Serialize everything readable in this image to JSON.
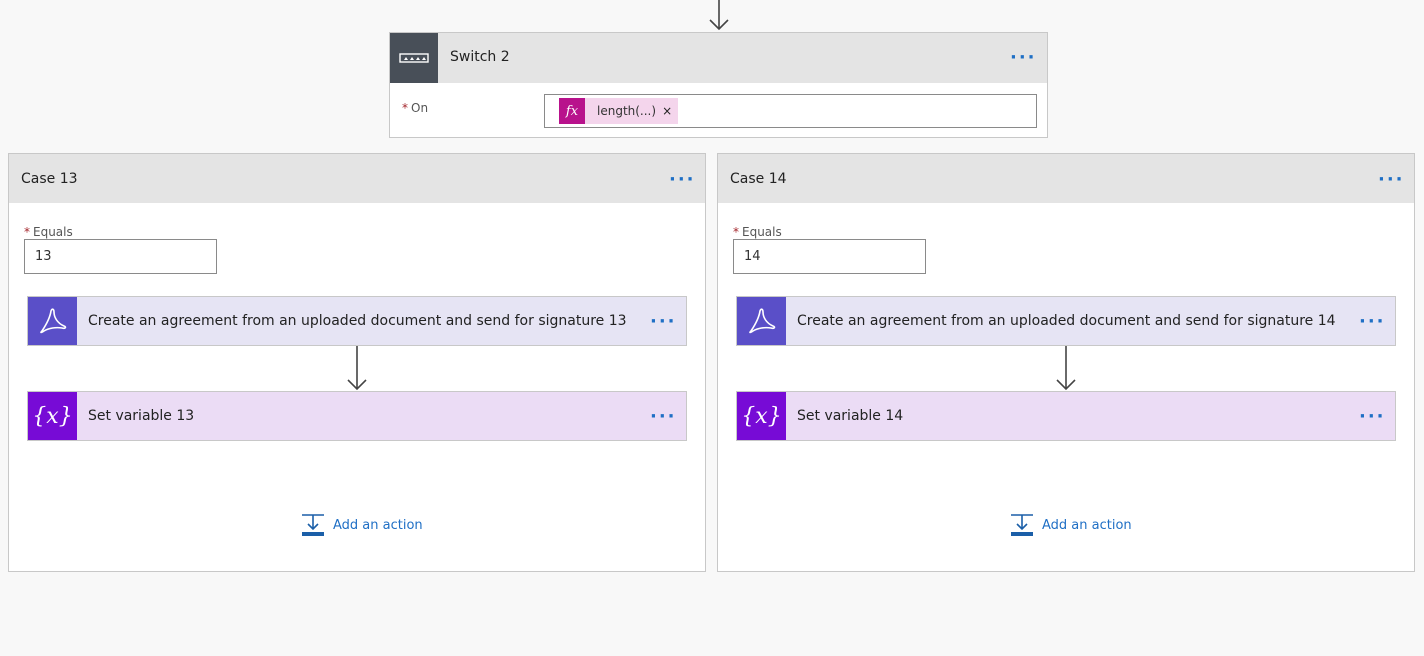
{
  "switch": {
    "title": "Switch 2",
    "on_required": "*",
    "on_label": "On",
    "token_icon": "fx",
    "token_text": "length(...)",
    "token_close": "×",
    "more": "···"
  },
  "cases": [
    {
      "title": "Case 13",
      "more": "···",
      "equals_required": "*",
      "equals_label": "Equals",
      "equals_value": "13",
      "actions": [
        {
          "label": "Create an agreement from an uploaded document and send for signature 13",
          "more": "···"
        },
        {
          "label": "Set variable 13",
          "icon": "{x}",
          "more": "···"
        }
      ],
      "add_action": "Add an action"
    },
    {
      "title": "Case 14",
      "more": "···",
      "equals_required": "*",
      "equals_label": "Equals",
      "equals_value": "14",
      "actions": [
        {
          "label": "Create an agreement from an uploaded document and send for signature 14",
          "more": "···"
        },
        {
          "label": "Set variable 14",
          "icon": "{x}",
          "more": "···"
        }
      ],
      "add_action": "Add an action"
    }
  ],
  "colors": {
    "switch_icon_bg": "#484f58",
    "adobe_icon_bg": "#5a4fc8",
    "variable_icon_bg": "#770bd6",
    "expression_token_bg": "#b8128c",
    "link_blue": "#1f6fc5"
  }
}
